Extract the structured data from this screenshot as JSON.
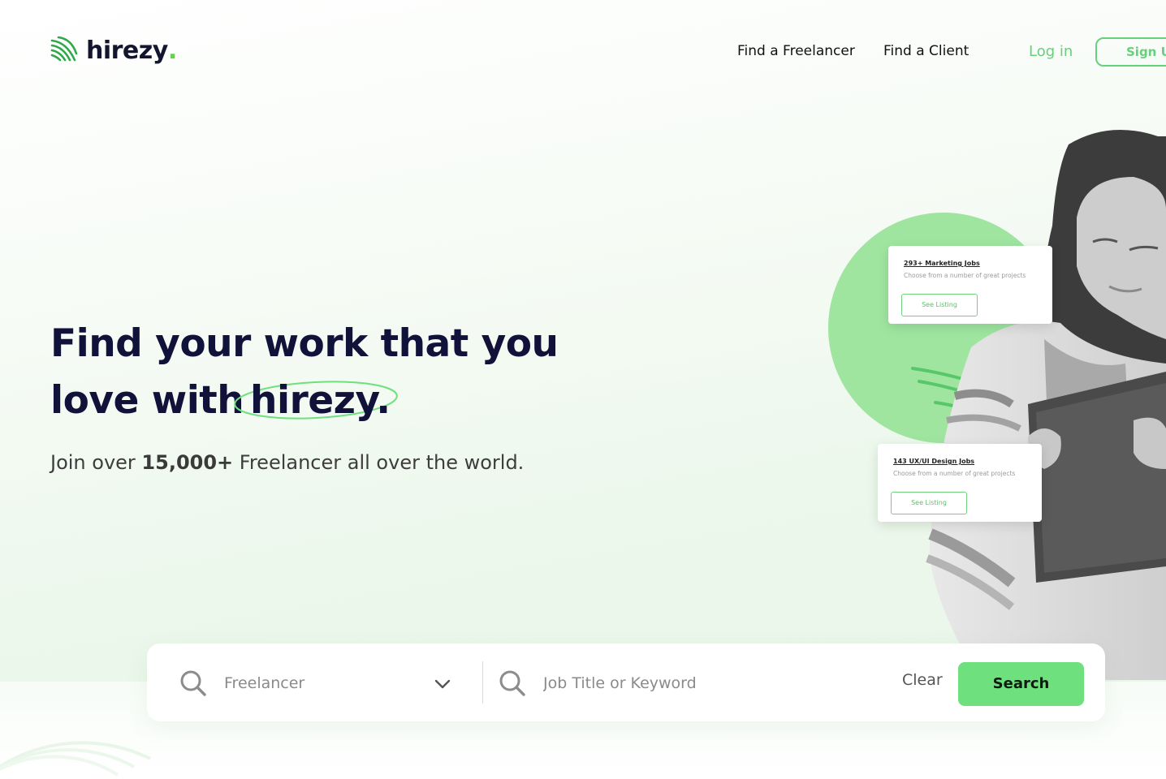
{
  "brand": {
    "name": "hirezy",
    "dot": "."
  },
  "nav": {
    "find_freelancer": "Find a Freelancer",
    "find_client": "Find a Client",
    "login": "Log in",
    "signup": "Sign Up"
  },
  "hero": {
    "line1": "Find your work that you",
    "line2_prefix": "love with",
    "line2_brand": "hirezy.",
    "sub_before": "Join over ",
    "sub_bold": "15,000+",
    "sub_after": " Freelancer all over the world."
  },
  "cards": [
    {
      "title": "293+ Marketing  Jobs",
      "desc": "Choose from a number of great projects",
      "button": "See Listing"
    },
    {
      "title": "143 UX/UI Design Jobs",
      "desc": "Choose from a number of great projects",
      "button": "See Listing"
    }
  ],
  "search": {
    "category_value": "Freelancer",
    "keyword_placeholder": "Job Title or Keyword",
    "clear": "Clear",
    "submit": "Search"
  },
  "icons": {
    "logo": "hirezy-logo-icon",
    "search": "search-icon",
    "dropdown": "chevron-down-icon"
  },
  "colors": {
    "accent": "#6ee07e",
    "accent_dark": "#2fa84a",
    "heading": "#10123a",
    "circle": "#9fe5a0"
  }
}
